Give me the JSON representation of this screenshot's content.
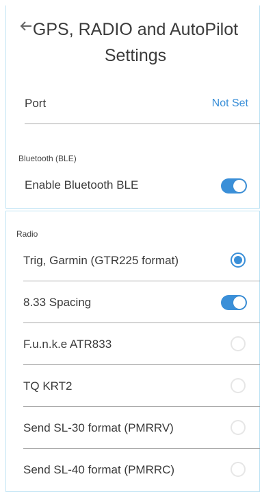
{
  "header": {
    "title": "GPS, RADIO and AutoPilot Settings",
    "back_icon": "back-arrow-icon"
  },
  "port": {
    "label": "Port",
    "value": "Not Set"
  },
  "bluetooth": {
    "section_title": "Bluetooth (BLE)",
    "enable_label": "Enable Bluetooth BLE",
    "enabled": true
  },
  "radio": {
    "section_title": "Radio",
    "items": [
      {
        "label": "Trig, Garmin (GTR225 format)",
        "control": "radio",
        "selected": true
      },
      {
        "label": "8.33 Spacing",
        "control": "toggle",
        "on": true
      },
      {
        "label": "F.u.n.k.e ATR833",
        "control": "radio",
        "selected": false
      },
      {
        "label": "TQ KRT2",
        "control": "radio",
        "selected": false
      },
      {
        "label": "Send SL-30 format (PMRRV)",
        "control": "radio",
        "selected": false
      },
      {
        "label": "Send SL-40 format (PMRRC)",
        "control": "radio",
        "selected": false
      }
    ]
  },
  "colors": {
    "accent": "#3a8fd8",
    "card_border": "#bfe3f4",
    "divider": "#a9a9a9"
  }
}
